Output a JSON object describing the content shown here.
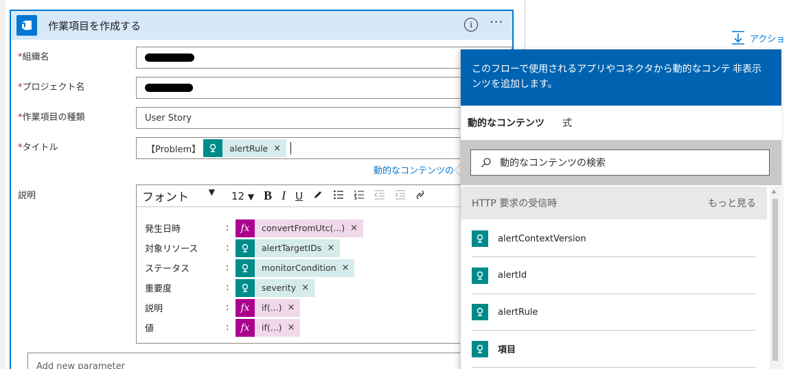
{
  "action": {
    "label": "アクショ"
  },
  "card": {
    "title": "作業項目を作成する",
    "info_icon": "i",
    "more_icon": "···"
  },
  "fields": {
    "org": {
      "label": "組織名"
    },
    "project": {
      "label": "プロジェクト名"
    },
    "type": {
      "label": "作業項目の種類",
      "value": "User Story"
    },
    "title": {
      "label": "タイトル",
      "prefix": "【Problem】",
      "token": "alertRule"
    },
    "desc": {
      "label": "説明"
    }
  },
  "dyn_link": "動的なコンテンツの",
  "editor": {
    "font": "フォント",
    "size": "12",
    "rows": [
      {
        "label": "発生日時",
        "token": "convertFromUtc(...)",
        "kind": "fx"
      },
      {
        "label": "対象リソース",
        "token": "alertTargetIDs",
        "kind": "teal"
      },
      {
        "label": "ステータス",
        "token": "monitorCondition",
        "kind": "teal"
      },
      {
        "label": "重要度",
        "token": "severity",
        "kind": "teal"
      },
      {
        "label": "説明",
        "token": "if(...)",
        "kind": "fx"
      },
      {
        "label": "値",
        "token": "if(...)",
        "kind": "fx"
      }
    ]
  },
  "add_param": {
    "placeholder": "Add new parameter"
  },
  "popup": {
    "description": "このフローで使用されるアプリやコネクタから動的なコンテンツを追加します。",
    "hide": "非表示",
    "tabs": [
      "動的なコンテンツ",
      "式"
    ],
    "search_placeholder": "動的なコンテンツの検索",
    "section": "HTTP 要求の受信時",
    "more": "もっと見る",
    "items": [
      "alertContextVersion",
      "alertId",
      "alertRule",
      "項目"
    ]
  },
  "colors": {
    "accent": "#0078d4",
    "header": "#0063b1",
    "teal": "#008b8b",
    "fx": "#ab008e"
  }
}
